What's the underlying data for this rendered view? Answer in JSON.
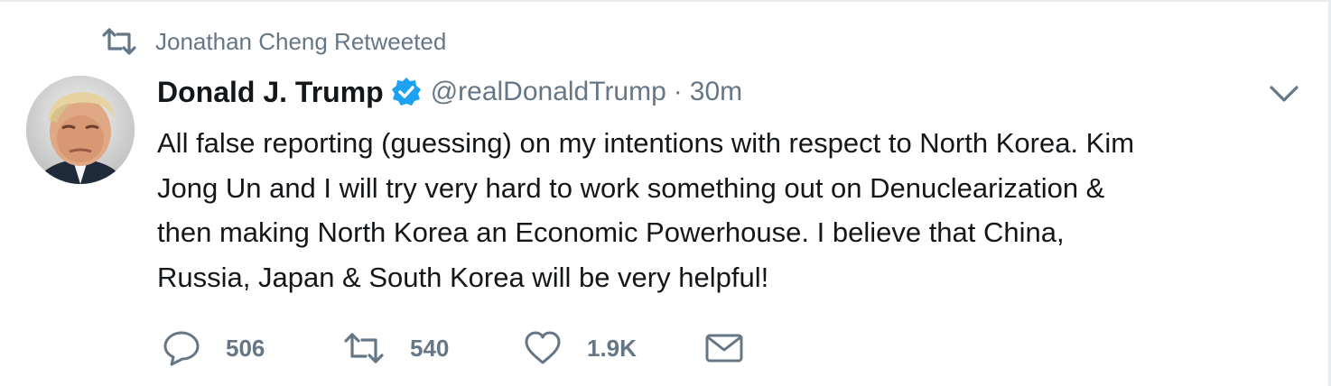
{
  "retweet_context": {
    "icon": "retweet-icon",
    "text": "Jonathan Cheng Retweeted"
  },
  "tweet": {
    "avatar_icon": "avatar",
    "display_name": "Donald J. Trump",
    "verified_icon": "verified-badge-icon",
    "handle": "@realDonaldTrump",
    "separator": "·",
    "timestamp": "30m",
    "text_lines": [
      "All false reporting (guessing) on my intentions with respect to North Korea. Kim",
      "Jong Un and I will try very hard to work something out on Denuclearization &",
      "then making North Korea an Economic Powerhouse. I believe that China,",
      "Russia, Japan & South Korea will be very helpful!"
    ],
    "menu_icon": "chevron-down-icon"
  },
  "actions": {
    "reply": {
      "icon": "reply-icon",
      "count": "506"
    },
    "retweet": {
      "icon": "retweet-icon",
      "count": "540"
    },
    "like": {
      "icon": "heart-icon",
      "count": "1.9K"
    },
    "message": {
      "icon": "envelope-icon"
    }
  },
  "colors": {
    "text": "#14171a",
    "secondary": "#657786",
    "verified": "#1da1f2",
    "border": "#e6ecf0"
  }
}
